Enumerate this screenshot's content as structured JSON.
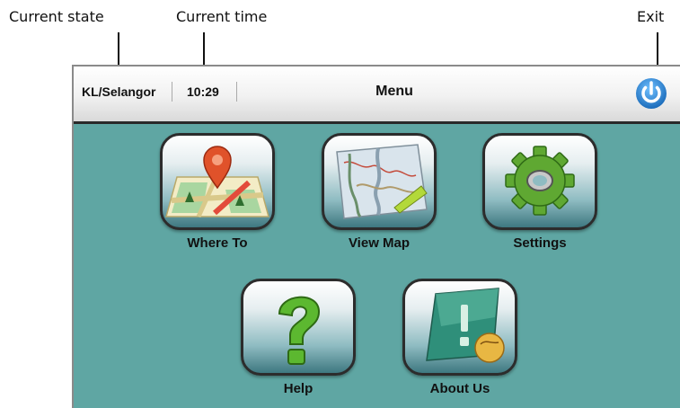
{
  "annotations": {
    "current_state": "Current state",
    "current_time": "Current time",
    "exit": "Exit"
  },
  "status_bar": {
    "state": "KL/Selangor",
    "time": "10:29",
    "title": "Menu",
    "exit_icon": "power-icon"
  },
  "menu": {
    "where_to": "Where To",
    "view_map": "View Map",
    "settings": "Settings",
    "help": "Help",
    "about_us": "About Us"
  },
  "colors": {
    "screen_background": "#5fa6a3",
    "exit_accent": "#1e7fd0"
  }
}
